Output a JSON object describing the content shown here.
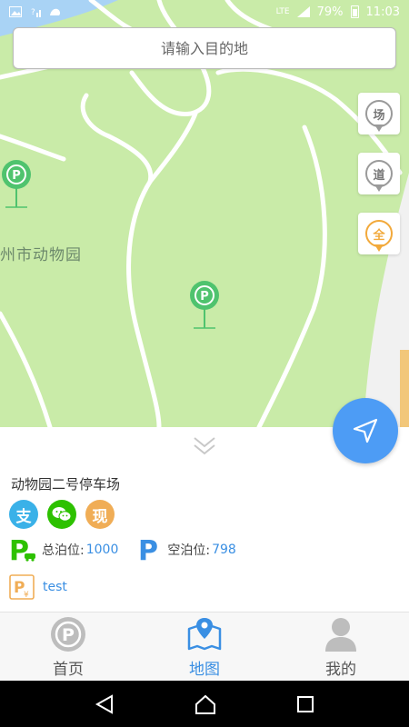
{
  "status_bar": {
    "network": "LTE",
    "battery": "79%",
    "time": "11:03"
  },
  "map": {
    "place_label": "州市动物园",
    "search_placeholder": "请输入目的地",
    "filters": [
      {
        "label": "场",
        "style": "grey"
      },
      {
        "label": "道",
        "style": "grey"
      },
      {
        "label": "全",
        "style": "orange"
      }
    ],
    "marker_color": "#4fc36e"
  },
  "parking_lot": {
    "name": "动物园二号停车场",
    "payment_methods": [
      {
        "icon": "alipay-icon",
        "label": "支"
      },
      {
        "icon": "wechat-icon",
        "label": ""
      },
      {
        "icon": "cash-icon",
        "label": "现"
      }
    ],
    "total_label": "总泊位:",
    "total_value": "1000",
    "empty_label": "空泊位:",
    "empty_value": "798",
    "price_text": "test"
  },
  "tabs": [
    {
      "label": "首页",
      "icon": "parking-icon",
      "active": false
    },
    {
      "label": "地图",
      "icon": "map-icon",
      "active": true
    },
    {
      "label": "我的",
      "icon": "user-icon",
      "active": false
    }
  ],
  "colors": {
    "accent": "#3a8fe3",
    "map_green": "#c9eba8",
    "parking_green": "#4fc36e",
    "locate_blue": "#4d9cf5"
  }
}
